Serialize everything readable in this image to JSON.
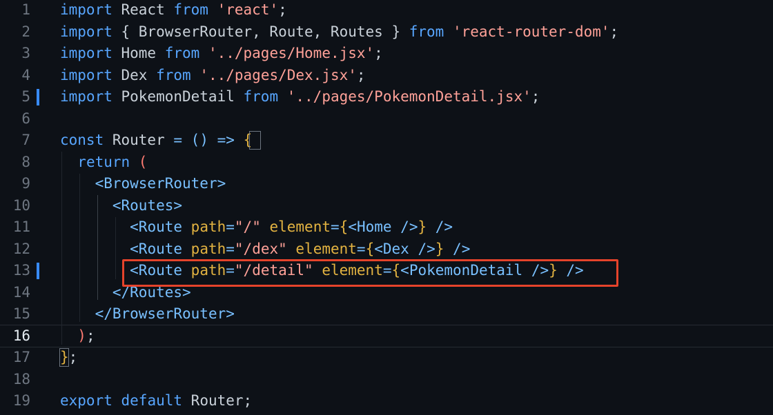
{
  "editor": {
    "lines": [
      {
        "num": "1",
        "tokens": [
          {
            "t": "import",
            "c": "kw"
          },
          {
            "t": " React ",
            "c": "ident"
          },
          {
            "t": "from",
            "c": "kw"
          },
          {
            "t": " ",
            "c": "ident"
          },
          {
            "t": "'react'",
            "c": "str"
          },
          {
            "t": ";",
            "c": "punct"
          }
        ]
      },
      {
        "num": "2",
        "tokens": [
          {
            "t": "import",
            "c": "kw"
          },
          {
            "t": " { BrowserRouter, Route, Routes } ",
            "c": "ident"
          },
          {
            "t": "from",
            "c": "kw"
          },
          {
            "t": " ",
            "c": "ident"
          },
          {
            "t": "'react-router-dom'",
            "c": "str"
          },
          {
            "t": ";",
            "c": "punct"
          }
        ]
      },
      {
        "num": "3",
        "tokens": [
          {
            "t": "import",
            "c": "kw"
          },
          {
            "t": " Home ",
            "c": "ident"
          },
          {
            "t": "from",
            "c": "kw"
          },
          {
            "t": " ",
            "c": "ident"
          },
          {
            "t": "'../pages/Home.jsx'",
            "c": "str"
          },
          {
            "t": ";",
            "c": "punct"
          }
        ]
      },
      {
        "num": "4",
        "tokens": [
          {
            "t": "import",
            "c": "kw"
          },
          {
            "t": " Dex ",
            "c": "ident"
          },
          {
            "t": "from",
            "c": "kw"
          },
          {
            "t": " ",
            "c": "ident"
          },
          {
            "t": "'../pages/Dex.jsx'",
            "c": "str"
          },
          {
            "t": ";",
            "c": "punct"
          }
        ]
      },
      {
        "num": "5",
        "modified": true,
        "tokens": [
          {
            "t": "import",
            "c": "kw"
          },
          {
            "t": " PokemonDetail ",
            "c": "ident"
          },
          {
            "t": "from",
            "c": "kw"
          },
          {
            "t": " ",
            "c": "ident"
          },
          {
            "t": "'../pages/PokemonDetail.jsx'",
            "c": "str"
          },
          {
            "t": ";",
            "c": "punct"
          }
        ]
      },
      {
        "num": "6",
        "tokens": []
      },
      {
        "num": "7",
        "tokens": [
          {
            "t": "const",
            "c": "kw"
          },
          {
            "t": " Router ",
            "c": "ident"
          },
          {
            "t": "=",
            "c": "op"
          },
          {
            "t": " () ",
            "c": "op"
          },
          {
            "t": "=>",
            "c": "op"
          },
          {
            "t": " ",
            "c": "ident"
          },
          {
            "t": "{",
            "c": "brace"
          }
        ]
      },
      {
        "num": "8",
        "tokens": [
          {
            "t": "  ",
            "c": "ident"
          },
          {
            "t": "return",
            "c": "kw"
          },
          {
            "t": " (",
            "c": "kw2"
          }
        ]
      },
      {
        "num": "9",
        "tokens": [
          {
            "t": "    ",
            "c": "ident"
          },
          {
            "t": "<BrowserRouter>",
            "c": "tag"
          }
        ]
      },
      {
        "num": "10",
        "tokens": [
          {
            "t": "      ",
            "c": "ident"
          },
          {
            "t": "<Routes>",
            "c": "tag"
          }
        ]
      },
      {
        "num": "11",
        "tokens": [
          {
            "t": "        ",
            "c": "ident"
          },
          {
            "t": "<Route ",
            "c": "tag"
          },
          {
            "t": "path",
            "c": "attr"
          },
          {
            "t": "=",
            "c": "op"
          },
          {
            "t": "\"/\"",
            "c": "str"
          },
          {
            "t": " element",
            "c": "attr"
          },
          {
            "t": "=",
            "c": "op"
          },
          {
            "t": "{",
            "c": "brace"
          },
          {
            "t": "<Home />",
            "c": "tag"
          },
          {
            "t": "}",
            "c": "brace"
          },
          {
            "t": " />",
            "c": "tag"
          }
        ]
      },
      {
        "num": "12",
        "tokens": [
          {
            "t": "        ",
            "c": "ident"
          },
          {
            "t": "<Route ",
            "c": "tag"
          },
          {
            "t": "path",
            "c": "attr"
          },
          {
            "t": "=",
            "c": "op"
          },
          {
            "t": "\"/dex\"",
            "c": "str"
          },
          {
            "t": " element",
            "c": "attr"
          },
          {
            "t": "=",
            "c": "op"
          },
          {
            "t": "{",
            "c": "brace"
          },
          {
            "t": "<Dex />",
            "c": "tag"
          },
          {
            "t": "}",
            "c": "brace"
          },
          {
            "t": " />",
            "c": "tag"
          }
        ]
      },
      {
        "num": "13",
        "modified": true,
        "tokens": [
          {
            "t": "        ",
            "c": "ident"
          },
          {
            "t": "<Route ",
            "c": "tag"
          },
          {
            "t": "path",
            "c": "attr"
          },
          {
            "t": "=",
            "c": "op"
          },
          {
            "t": "\"/detail\"",
            "c": "str"
          },
          {
            "t": " element",
            "c": "attr"
          },
          {
            "t": "=",
            "c": "op"
          },
          {
            "t": "{",
            "c": "brace"
          },
          {
            "t": "<PokemonDetail />",
            "c": "tag"
          },
          {
            "t": "}",
            "c": "brace"
          },
          {
            "t": " />",
            "c": "tag"
          }
        ]
      },
      {
        "num": "14",
        "tokens": [
          {
            "t": "      ",
            "c": "ident"
          },
          {
            "t": "</Routes>",
            "c": "tag"
          }
        ]
      },
      {
        "num": "15",
        "tokens": [
          {
            "t": "    ",
            "c": "ident"
          },
          {
            "t": "</BrowserRouter>",
            "c": "tag"
          }
        ]
      },
      {
        "num": "16",
        "current": true,
        "tokens": [
          {
            "t": "  ",
            "c": "ident"
          },
          {
            "t": ")",
            "c": "kw2"
          },
          {
            "t": ";",
            "c": "punct"
          }
        ]
      },
      {
        "num": "17",
        "tokens": [
          {
            "t": "}",
            "c": "brace"
          },
          {
            "t": ";",
            "c": "punct"
          }
        ]
      },
      {
        "num": "18",
        "tokens": []
      },
      {
        "num": "19",
        "tokens": [
          {
            "t": "export",
            "c": "kw"
          },
          {
            "t": " ",
            "c": "ident"
          },
          {
            "t": "default",
            "c": "kw"
          },
          {
            "t": " Router;",
            "c": "ident"
          }
        ]
      }
    ]
  },
  "colors": {
    "background": "#0d1117",
    "keyword": "#58a6ff",
    "string": "#ffa198",
    "tag": "#79c0ff",
    "attribute": "#e3b341",
    "modified_marker": "#388bfd",
    "highlight_box": "#e5432b"
  }
}
